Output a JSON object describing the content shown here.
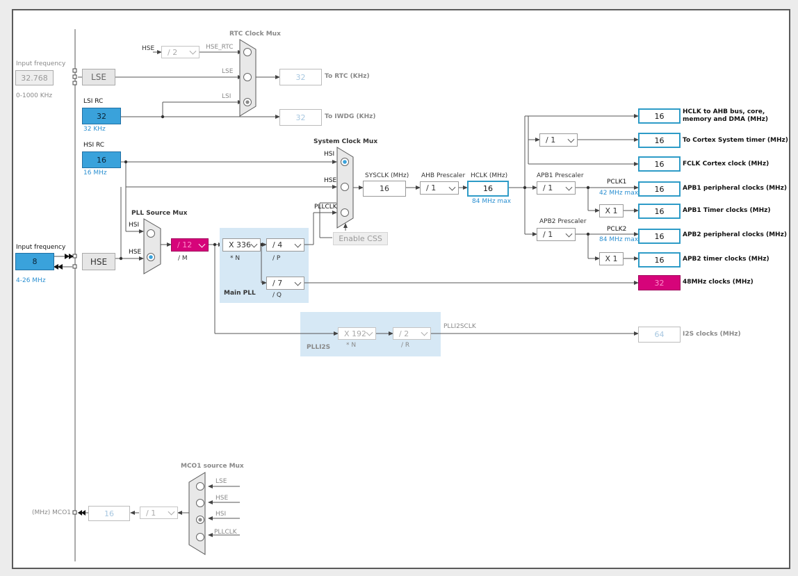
{
  "rtc": {
    "title": "RTC Clock Mux",
    "hse_label": "HSE",
    "div_value": "/ 2",
    "hse_rtc_label": "HSE_RTC",
    "lse_label": "LSE",
    "lsi_label": "LSI",
    "out_value": "32",
    "out_label": "To RTC (KHz)",
    "iwdg_value": "32",
    "iwdg_label": "To IWDG (KHz)"
  },
  "lse": {
    "input_label": "Input frequency",
    "input_value": "32.768",
    "range": "0-1000 KHz",
    "block_label": "LSE"
  },
  "lsi": {
    "title": "LSI RC",
    "value": "32",
    "freq": "32 KHz"
  },
  "hsi": {
    "title": "HSI RC",
    "value": "16",
    "freq": "16 MHz"
  },
  "hse": {
    "input_label": "Input frequency",
    "input_value": "8",
    "range": "4-26 MHz",
    "block_label": "HSE"
  },
  "pll_source": {
    "title": "PLL Source Mux",
    "hsi_label": "HSI",
    "hse_label": "HSE",
    "m_value": "/ 12",
    "m_label": "/ M"
  },
  "main_pll": {
    "title": "Main PLL",
    "n_value": "X 336",
    "n_label": "* N",
    "p_value": "/ 4",
    "p_label": "/ P",
    "q_value": "/ 7",
    "q_label": "/ Q"
  },
  "sysmux": {
    "title": "System Clock Mux",
    "hsi_label": "HSI",
    "hse_label": "HSE",
    "pllclk_label": "PLLCLK",
    "css_button": "Enable CSS"
  },
  "sysclk": {
    "label": "SYSCLK (MHz)",
    "value": "16"
  },
  "ahb": {
    "label": "AHB Prescaler",
    "value": "/ 1"
  },
  "hclk": {
    "label": "HCLK (MHz)",
    "value": "16",
    "max": "84 MHz max"
  },
  "cortex_div": "/ 1",
  "apb1": {
    "label": "APB1 Prescaler",
    "value": "/ 1",
    "pclk_label": "PCLK1",
    "max": "42 MHz max",
    "timer_mult": "X 1"
  },
  "apb2": {
    "label": "APB2 Prescaler",
    "value": "/ 1",
    "pclk_label": "PCLK2",
    "max": "84 MHz max",
    "timer_mult": "X 1"
  },
  "outputs": {
    "hclk_ahb": {
      "value": "16",
      "label": "HCLK to AHB bus, core, memory and DMA (MHz)"
    },
    "cortex_timer": {
      "value": "16",
      "label": "To Cortex System timer (MHz)"
    },
    "fclk": {
      "value": "16",
      "label": "FCLK Cortex clock (MHz)"
    },
    "apb1_periph": {
      "value": "16",
      "label": "APB1 peripheral clocks (MHz)"
    },
    "apb1_timer": {
      "value": "16",
      "label": "APB1 Timer clocks (MHz)"
    },
    "apb2_periph": {
      "value": "16",
      "label": "APB2 peripheral clocks (MHz)"
    },
    "apb2_timer": {
      "value": "16",
      "label": "APB2 timer clocks (MHz)"
    },
    "clk48": {
      "value": "32",
      "label": "48MHz clocks (MHz)"
    },
    "i2s": {
      "value": "64",
      "label": "I2S clocks (MHz)"
    }
  },
  "plli2s": {
    "title": "PLLI2S",
    "n_value": "X 192",
    "n_label": "* N",
    "r_value": "/ 2",
    "r_label": "/ R",
    "out_label": "PLLI2SCLK"
  },
  "mco1": {
    "title": "MCO1 source Mux",
    "lse_label": "LSE",
    "hse_label": "HSE",
    "hsi_label": "HSI",
    "pllclk_label": "PLLCLK",
    "div_value": "/ 1",
    "value": "16",
    "out_label": "(MHz) MCO1"
  },
  "colors": {
    "accent_blue": "#3aa2db",
    "output_border": "#2d9bc7",
    "error_magenta": "#d6047a",
    "pll_region": "#d6e8f5"
  }
}
